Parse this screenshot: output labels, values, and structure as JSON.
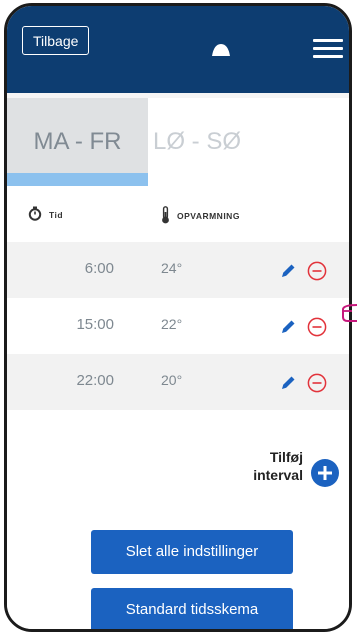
{
  "header": {
    "back_label": "Tilbage",
    "logo_icon": "device-dome-icon",
    "menu_icon": "hamburger-menu-icon",
    "bg_color": "#0d3d71"
  },
  "tabs": [
    {
      "label": "MA - FR",
      "active": true
    },
    {
      "label": "LØ - SØ",
      "active": false
    }
  ],
  "columns": {
    "time_label": "Tid",
    "heating_label": "OPVARMNING",
    "time_icon": "stopwatch-icon",
    "heating_icon": "thermometer-icon"
  },
  "intervals": [
    {
      "time": "6:00",
      "temp": "24°"
    },
    {
      "time": "15:00",
      "temp": "22°"
    },
    {
      "time": "22:00",
      "temp": "20°"
    }
  ],
  "add_interval": {
    "line1": "Tilføj",
    "line2": "interval",
    "icon": "plus-circle-icon"
  },
  "buttons": {
    "delete_all": "Slet alle indstillinger",
    "default_schedule": "Standard tidsskema"
  },
  "colors": {
    "accent": "#1b62c0",
    "remove": "#e2333b",
    "tab_indicator": "#8cc1ee"
  }
}
